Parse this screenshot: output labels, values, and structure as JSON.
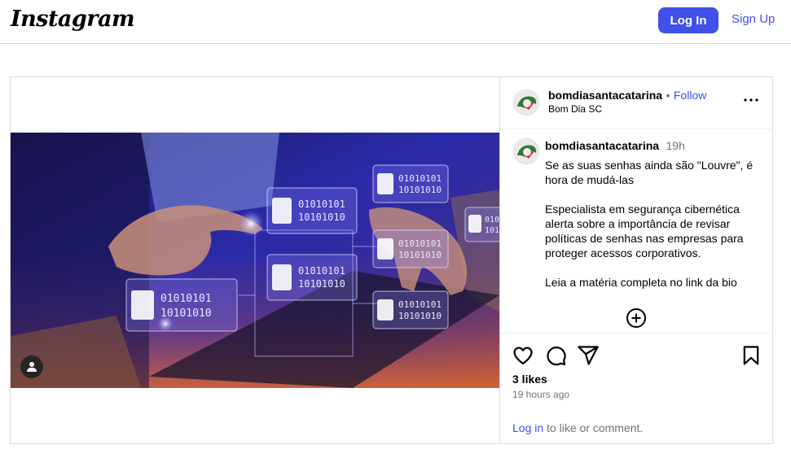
{
  "topbar": {
    "logo": "Instagram",
    "login_label": "Log In",
    "signup_label": "Sign Up"
  },
  "post": {
    "author": {
      "username": "bomdiasantacatarina",
      "subtitle": "Bom Dia SC",
      "follow_label": "Follow",
      "separator": "•"
    },
    "caption": {
      "username": "bomdiasantacatarina",
      "time": "19h",
      "text": "Se as suas senhas ainda são \"Louvre\", é hora de mudá-las\n\nEspecialista em segurança cibernética alerta sobre a importância de revisar políticas de senhas nas empresas para proteger acessos corporativos.\n\nLeia a matéria completa no link da bio"
    },
    "image": {
      "binary_text": "01010101 10101010"
    },
    "likes": "3 likes",
    "time_ago": "19 hours ago",
    "login_prompt": {
      "link": "Log in",
      "text": " to like or comment."
    }
  },
  "icons": {
    "like": "heart-icon",
    "comment": "comment-icon",
    "share": "share-icon",
    "save": "bookmark-icon",
    "more": "more-icon",
    "add_comment": "add-circle-icon",
    "user_tag": "user-icon"
  },
  "colors": {
    "accent": "#3f51e8",
    "border": "#dbdbdb",
    "muted": "#737373"
  }
}
